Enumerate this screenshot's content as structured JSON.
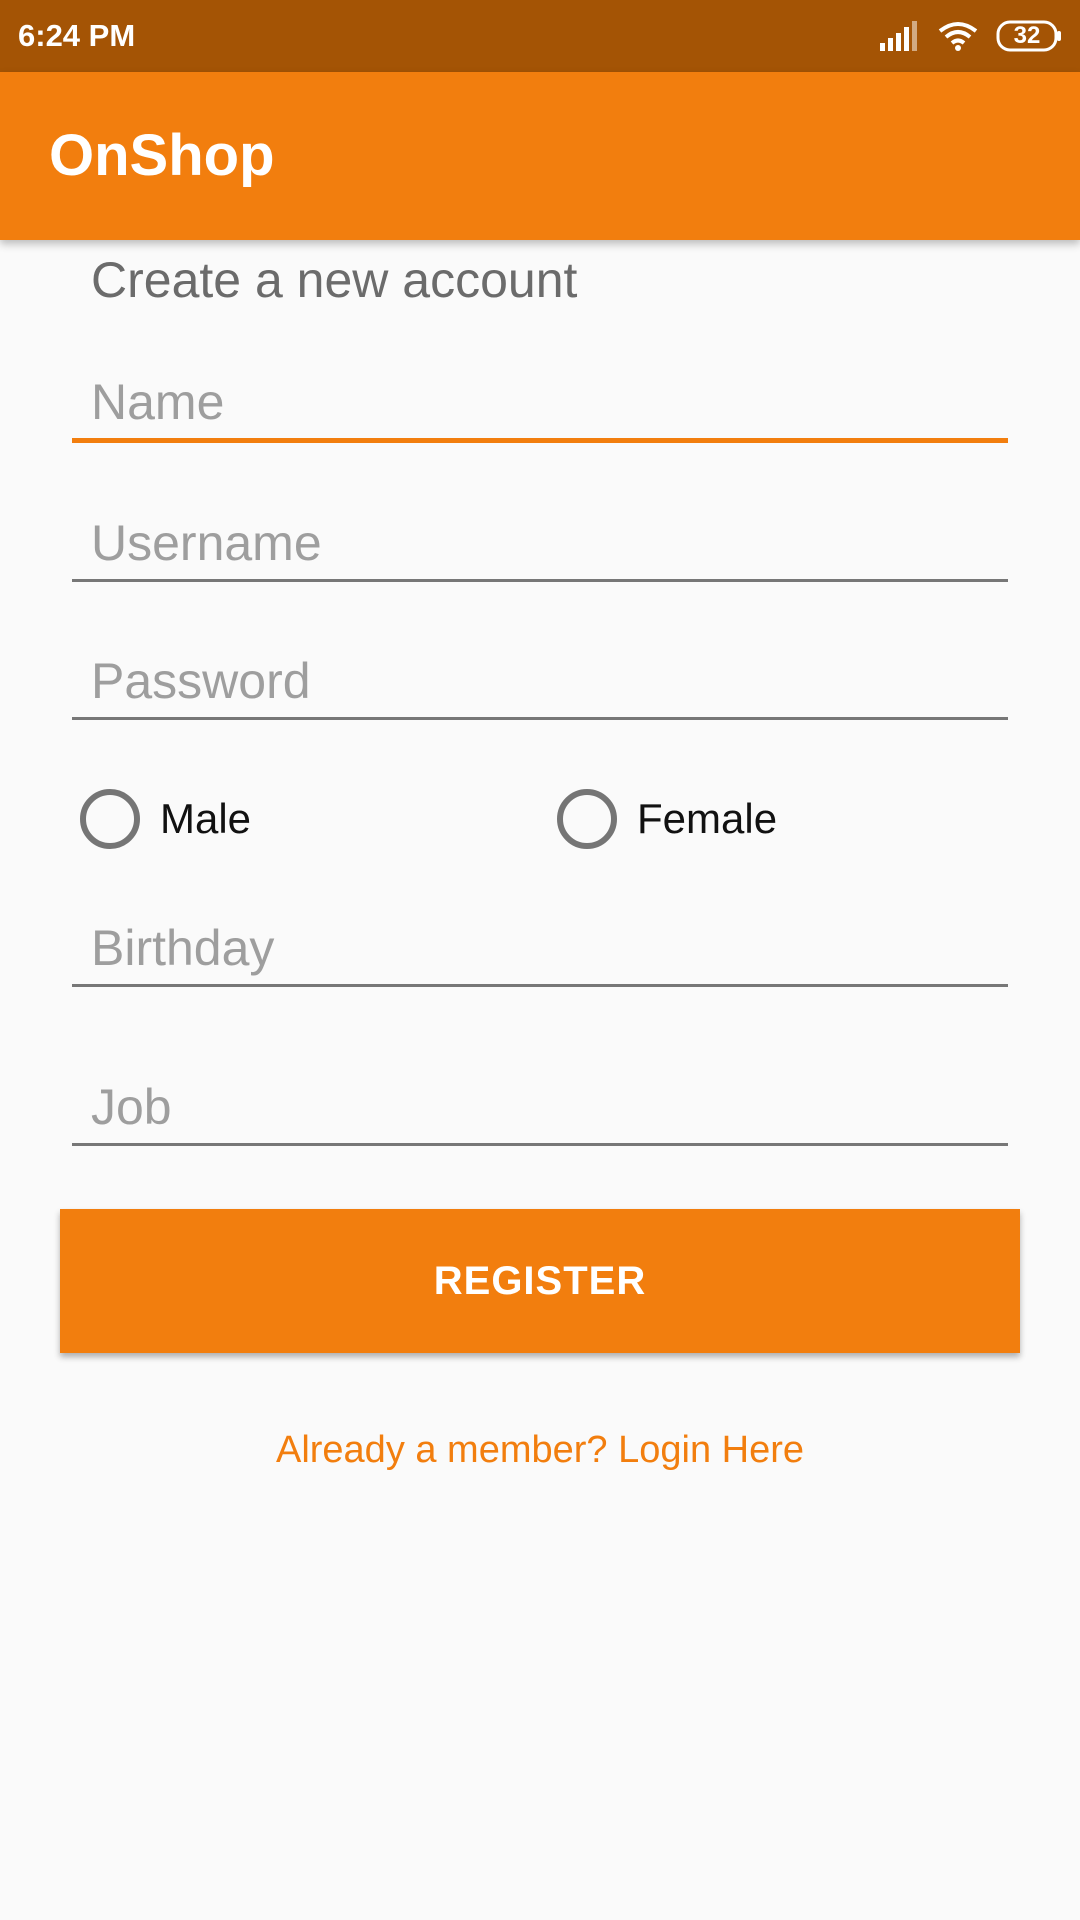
{
  "status_bar": {
    "time": "6:24 PM",
    "battery": "32",
    "icons": [
      "signal-icon",
      "wifi-icon",
      "battery-icon"
    ]
  },
  "app_bar": {
    "title": "OnShop"
  },
  "form": {
    "heading": "Create a new account",
    "fields": {
      "name": {
        "placeholder": "Name",
        "value": ""
      },
      "username": {
        "placeholder": "Username",
        "value": ""
      },
      "password": {
        "placeholder": "Password",
        "value": ""
      },
      "birthday": {
        "placeholder": "Birthday",
        "value": ""
      },
      "job": {
        "placeholder": "Job",
        "value": ""
      }
    },
    "gender": {
      "male_label": "Male",
      "female_label": "Female",
      "selected": null
    },
    "register_label": "REGISTER",
    "login_link": "Already a member? Login Here"
  },
  "colors": {
    "accent": "#f27e0e",
    "status_bar": "#a45405",
    "background": "#fafafa"
  }
}
